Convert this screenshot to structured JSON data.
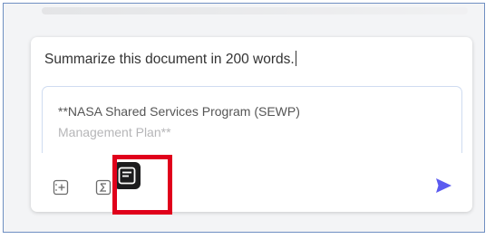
{
  "prompt": {
    "text": "Summarize this document in 200 words."
  },
  "document": {
    "title_line": "**NASA Shared Services Program (SEWP)",
    "subtitle_line": "Management Plan**"
  },
  "toolbar": {
    "icons": [
      "add-to-context-icon",
      "summary-sigma-icon",
      "document-icon"
    ],
    "send_icon": "send-icon",
    "highlight_color": "#e0001b"
  },
  "colors": {
    "send": "#5b5bf0"
  }
}
